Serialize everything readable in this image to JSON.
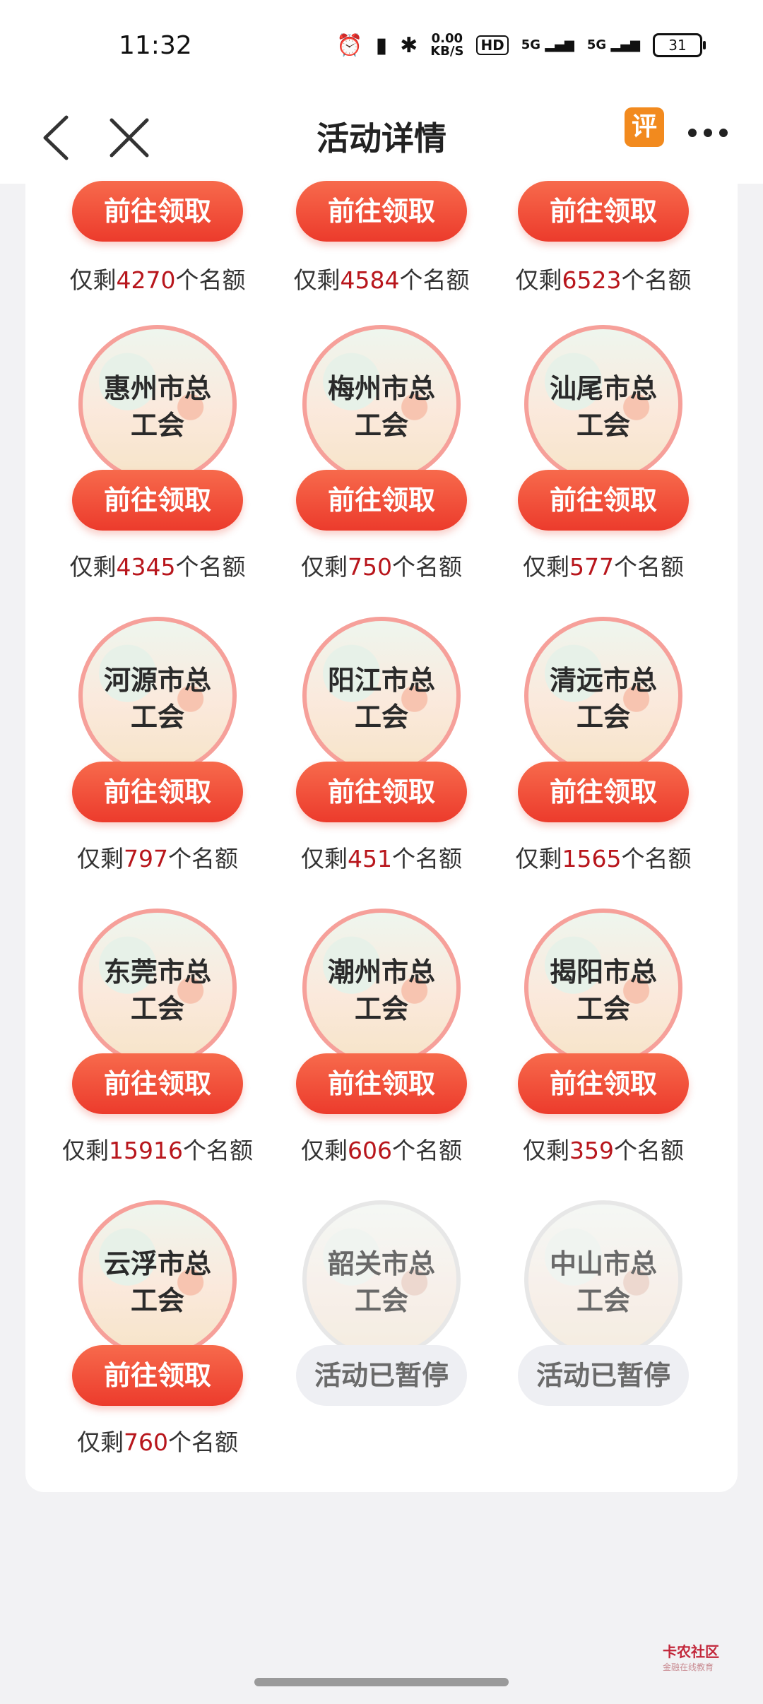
{
  "status_bar": {
    "time": "11:32",
    "net_speed": "0.00",
    "net_unit": "KB/S",
    "hd": "HD",
    "signal1": "5G",
    "signal2": "5G",
    "battery": "31",
    "icons": [
      "alarm-icon",
      "vibrate-icon",
      "bluetooth-icon",
      "signal-icon",
      "battery-icon"
    ]
  },
  "header": {
    "title": "活动详情",
    "rate_label": "评"
  },
  "grid": {
    "top_row": [
      {
        "btn": "前往领取",
        "prefix": "仅剩",
        "count": "4270",
        "suffix": "个名额"
      },
      {
        "btn": "前往领取",
        "prefix": "仅剩",
        "count": "4584",
        "suffix": "个名额"
      },
      {
        "btn": "前往领取",
        "prefix": "仅剩",
        "count": "6523",
        "suffix": "个名额"
      }
    ],
    "rows": [
      [
        {
          "name": "惠州市总工会",
          "l1": "惠州市总",
          "l2": "工会",
          "btn": "前往领取",
          "prefix": "仅剩",
          "count": "4345",
          "suffix": "个名额"
        },
        {
          "name": "梅州市总工会",
          "l1": "梅州市总",
          "l2": "工会",
          "btn": "前往领取",
          "prefix": "仅剩",
          "count": "750",
          "suffix": "个名额"
        },
        {
          "name": "汕尾市总工会",
          "l1": "汕尾市总",
          "l2": "工会",
          "btn": "前往领取",
          "prefix": "仅剩",
          "count": "577",
          "suffix": "个名额"
        }
      ],
      [
        {
          "name": "河源市总工会",
          "l1": "河源市总",
          "l2": "工会",
          "btn": "前往领取",
          "prefix": "仅剩",
          "count": "797",
          "suffix": "个名额"
        },
        {
          "name": "阳江市总工会",
          "l1": "阳江市总",
          "l2": "工会",
          "btn": "前往领取",
          "prefix": "仅剩",
          "count": "451",
          "suffix": "个名额"
        },
        {
          "name": "清远市总工会",
          "l1": "清远市总",
          "l2": "工会",
          "btn": "前往领取",
          "prefix": "仅剩",
          "count": "1565",
          "suffix": "个名额"
        }
      ],
      [
        {
          "name": "东莞市总工会",
          "l1": "东莞市总",
          "l2": "工会",
          "btn": "前往领取",
          "prefix": "仅剩",
          "count": "15916",
          "suffix": "个名额"
        },
        {
          "name": "潮州市总工会",
          "l1": "潮州市总",
          "l2": "工会",
          "btn": "前往领取",
          "prefix": "仅剩",
          "count": "606",
          "suffix": "个名额"
        },
        {
          "name": "揭阳市总工会",
          "l1": "揭阳市总",
          "l2": "工会",
          "btn": "前往领取",
          "prefix": "仅剩",
          "count": "359",
          "suffix": "个名额"
        }
      ],
      [
        {
          "name": "云浮市总工会",
          "l1": "云浮市总",
          "l2": "工会",
          "btn": "前往领取",
          "prefix": "仅剩",
          "count": "760",
          "suffix": "个名额"
        },
        {
          "name": "韶关市总工会",
          "l1": "韶关市总",
          "l2": "工会",
          "btn": "活动已暂停",
          "paused": true
        },
        {
          "name": "中山市总工会",
          "l1": "中山市总",
          "l2": "工会",
          "btn": "活动已暂停",
          "paused": true
        }
      ]
    ]
  },
  "watermark": {
    "text": "卡农社区",
    "sub": "金融在线教育"
  },
  "colors": {
    "accent": "#ec3b2c",
    "count": "#b8161c",
    "paused_bg": "#eeeff3"
  }
}
